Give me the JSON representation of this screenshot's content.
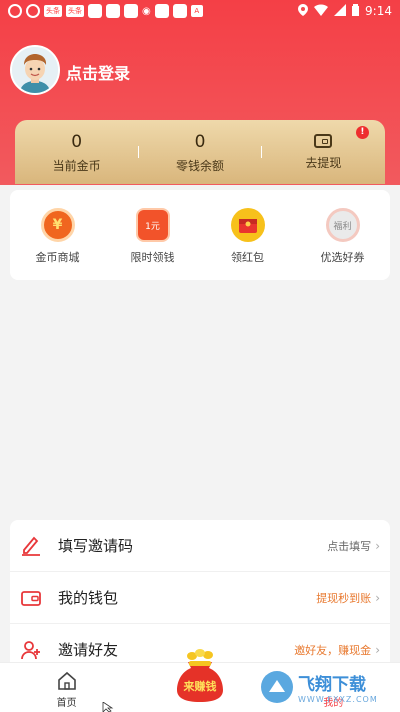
{
  "status_bar": {
    "time": "9:14",
    "left_tags": [
      "头条",
      "头条"
    ],
    "badge_letter": "A"
  },
  "user": {
    "login_text": "点击登录"
  },
  "stats": [
    {
      "value": "0",
      "label": "当前金币"
    },
    {
      "value": "0",
      "label": "零钱余额"
    },
    {
      "label": "去提现",
      "badge": "!"
    }
  ],
  "quick_menu": [
    {
      "label": "金币商城",
      "icon": "coin-mall-icon",
      "glyph": "¥",
      "color": "#f0661f"
    },
    {
      "label": "限时领钱",
      "icon": "timed-cash-icon",
      "glyph": "1元",
      "color": "#f2532a"
    },
    {
      "label": "领红包",
      "icon": "red-packet-icon",
      "glyph": "",
      "color": "#f7c11b"
    },
    {
      "label": "优选好券",
      "icon": "coupon-icon",
      "glyph": "福利",
      "color": "#e9e9e9"
    }
  ],
  "list": [
    {
      "title": "填写邀请码",
      "right": "点击填写",
      "right_color": "#666666",
      "icon": "pen-icon"
    },
    {
      "title": "我的钱包",
      "right": "提现秒到账",
      "right_color": "#e8792f",
      "icon": "wallet-icon"
    },
    {
      "title": "邀请好友",
      "right": "邀好友，赚现金",
      "right_color": "#e8792f",
      "icon": "add-friend-icon"
    }
  ],
  "tabbar": {
    "home": "首页",
    "earn": "来赚钱",
    "mine": "我的"
  },
  "watermark": {
    "text": "飞翔下载",
    "url": "WWW.FXXZ.COM"
  },
  "colors": {
    "primary": "#f43f46",
    "gold": "#d9b67c",
    "accent": "#e8792f"
  }
}
